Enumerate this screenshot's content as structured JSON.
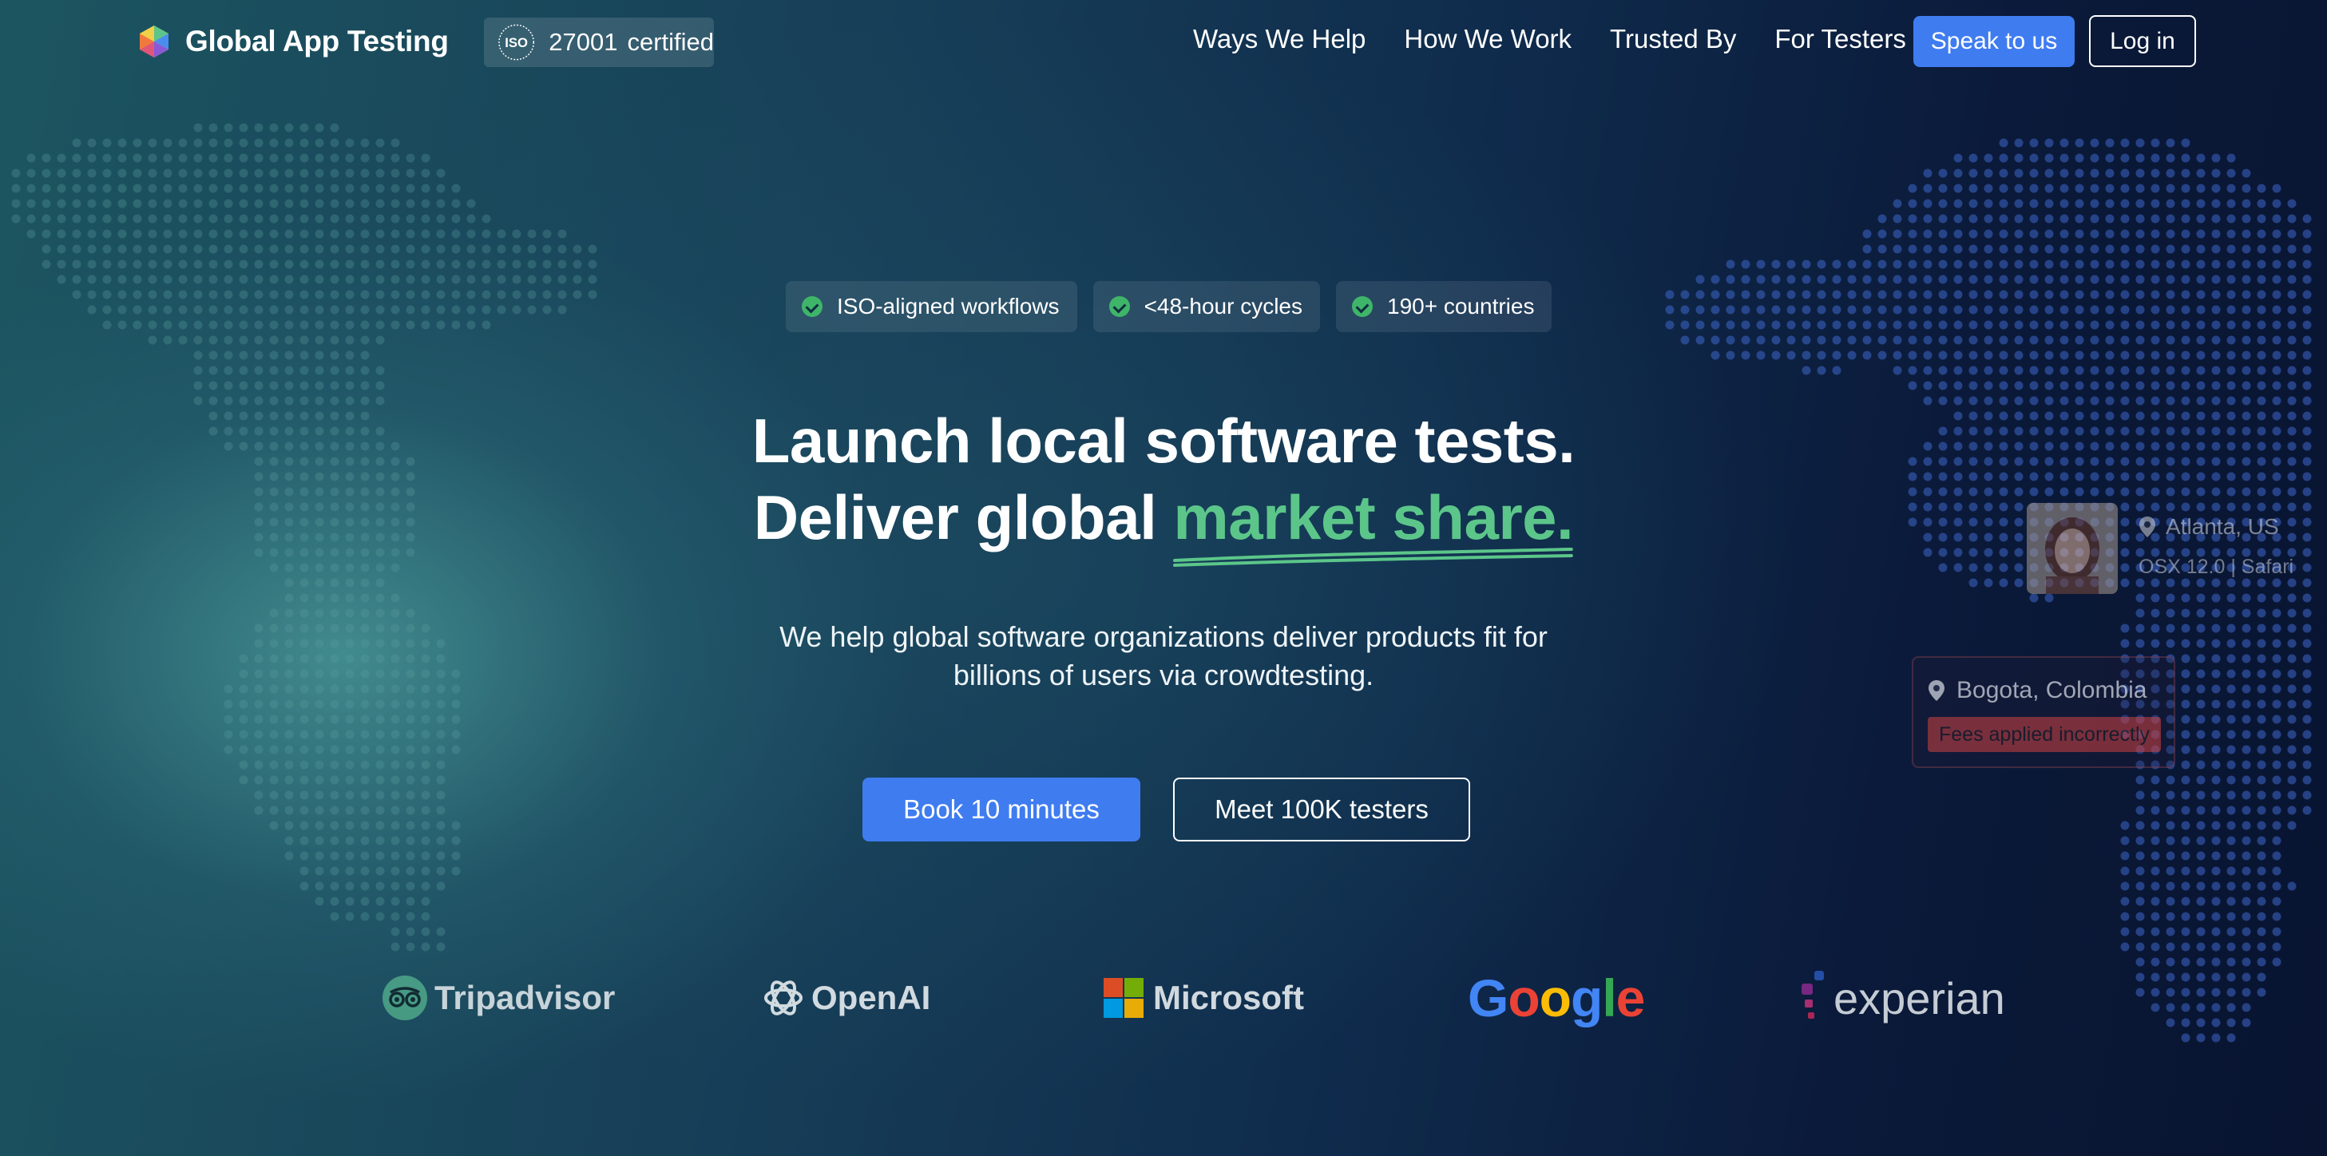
{
  "nav": {
    "brand": "Global App Testing",
    "iso_badge": {
      "seal": "ISO",
      "number": "27001",
      "label": "certified"
    },
    "links": [
      "Ways We Help",
      "How We Work",
      "Trusted By",
      "For Testers"
    ],
    "speak_button": "Speak to us",
    "login_button": "Log in"
  },
  "features": [
    "ISO-aligned workflows",
    "<48-hour cycles",
    "190+ countries"
  ],
  "hero": {
    "line1": "Launch local software tests.",
    "line2_prefix": "Deliver global",
    "line2_accent": "market share.",
    "subtitle_line1": "We help global software organizations deliver products fit for",
    "subtitle_line2": "billions of users via crowdtesting.",
    "primary_cta": "Book 10 minutes",
    "secondary_cta": "Meet 100K testers"
  },
  "tester_cards": {
    "atlanta": {
      "location": "Atlanta, US",
      "device": "OSX 12.0 | Safari"
    },
    "bogota": {
      "location": "Bogota, Colombia",
      "issue": "Fees applied incorrectly"
    }
  },
  "client_logos": [
    "Tripadvisor",
    "OpenAI",
    "Microsoft",
    "Google",
    "experian"
  ],
  "colors": {
    "accent_green": "#5cc68a",
    "primary_blue": "#3f7cf0",
    "map_dots_blue": "#3e66c8",
    "map_dots_teal": "#5a9aa0",
    "issue_red": "#cd4141"
  },
  "icons": [
    "app-logo-icon",
    "iso-seal-icon",
    "check-icon",
    "location-pin-icon",
    "tripadvisor-icon",
    "openai-icon",
    "microsoft-icon",
    "experian-icon"
  ]
}
